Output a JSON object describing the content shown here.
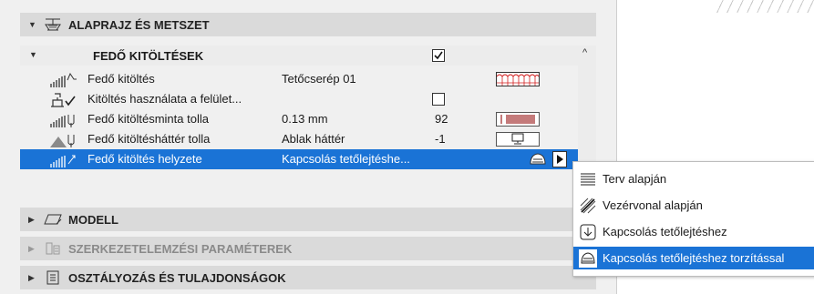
{
  "sections": {
    "floor_plan": "ALAPRAJZ ÉS METSZET",
    "model": "MODELL",
    "structural": "SZERKEZETELEMZÉSI PARAMÉTEREK",
    "classification": "OSZTÁLYOZÁS ÉS TULAJDONSÁGOK"
  },
  "subsection": {
    "title": "FEDŐ KITÖLTÉSEK",
    "checked": true
  },
  "rows": [
    {
      "label": "Fedő kitöltés",
      "value": "Tetőcserép 01",
      "number": ""
    },
    {
      "label": "Kitöltés használata a felület...",
      "value": "",
      "number": ""
    },
    {
      "label": "Fedő kitöltésminta tolla",
      "value": "0.13 mm",
      "number": "92"
    },
    {
      "label": "Fedő kitöltésháttér tolla",
      "value": "Ablak háttér",
      "number": "-1"
    },
    {
      "label": "Fedő kitöltés helyzete",
      "value": "Kapcsolás tetőlejtéshe...",
      "number": ""
    }
  ],
  "dropdown": {
    "items": [
      {
        "label": "Terv alapján",
        "icon": "project-origin-icon"
      },
      {
        "label": "Vezérvonal alapján",
        "icon": "ref-line-icon"
      },
      {
        "label": "Kapcsolás tetőlejtéshez",
        "icon": "link-to-slope-icon"
      },
      {
        "label": "Kapcsolás tetőlejtéshez torzítással",
        "icon": "link-to-slope-distort-icon"
      }
    ],
    "selected_index": 3
  },
  "colors": {
    "selection": "#1a73d6",
    "pen_red": "#c47a7a",
    "cut_fill_red": "#d22020"
  }
}
